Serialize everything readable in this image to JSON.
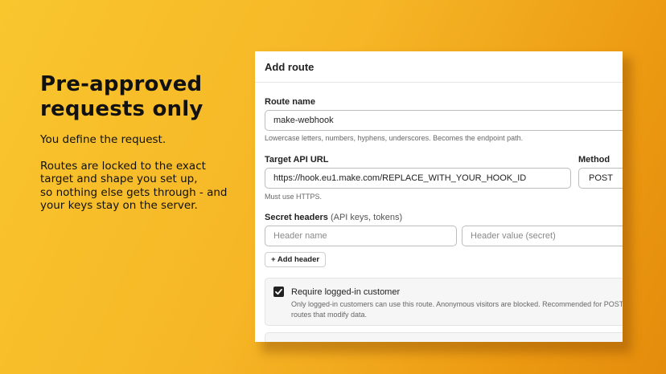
{
  "hero": {
    "title_line1": "Pre-approved",
    "title_line2": "requests only",
    "para1": "You define the request.",
    "para2_line1": "Routes are locked to the exact",
    "para2_line2": "target and shape you set up,",
    "para2_line3": "so nothing else gets through - and",
    "para2_line4": "your keys stay on the server."
  },
  "panel": {
    "title": "Add route",
    "route_name": {
      "label": "Route name",
      "value": "make-webhook",
      "help": "Lowercase letters, numbers, hyphens, underscores. Becomes the endpoint path."
    },
    "target_url": {
      "label": "Target API URL",
      "value": "https://hook.eu1.make.com/REPLACE_WITH_YOUR_HOOK_ID",
      "help": "Must use HTTPS."
    },
    "method": {
      "label": "Method",
      "value": "POST"
    },
    "secret_headers": {
      "label": "Secret headers",
      "label_note": "(API keys, tokens)",
      "name_placeholder": "Header name",
      "value_placeholder": "Header value (secret)",
      "add_button": "+ Add header"
    },
    "require_login": {
      "checked": true,
      "title": "Require logged-in customer",
      "desc_line1": "Only logged-in customers can use this route. Anonymous visitors are blocked. Recommended for POST",
      "desc_line2": "routes that modify data."
    }
  }
}
